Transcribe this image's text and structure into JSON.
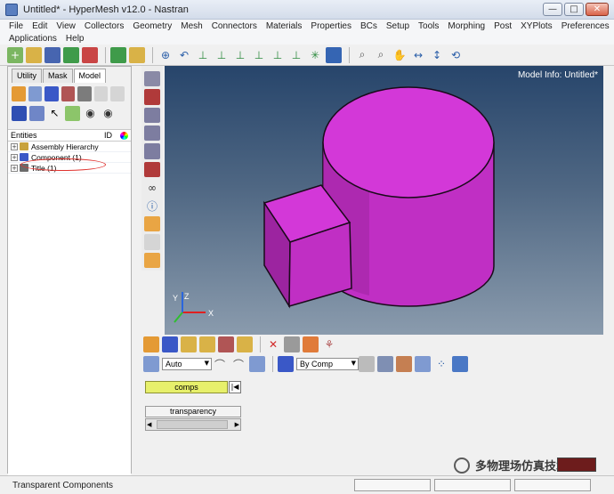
{
  "window": {
    "title": "Untitled* - HyperMesh v12.0 - Nastran",
    "minimize": "—",
    "maximize": "□",
    "close": "✕"
  },
  "menu": {
    "row1": [
      "File",
      "Edit",
      "View",
      "Collectors",
      "Geometry",
      "Mesh",
      "Connectors",
      "Materials",
      "Properties",
      "BCs",
      "Setup",
      "Tools",
      "Morphing",
      "Post",
      "XYPlots",
      "Preferences"
    ],
    "row2": [
      "Applications",
      "Help"
    ]
  },
  "left_panel": {
    "tabs": [
      "Utility",
      "Mask",
      "Model"
    ],
    "active_tab": "Model",
    "entity_header": {
      "title": "Entities",
      "id": "ID"
    },
    "entities": [
      {
        "label": "Assembly Hierarchy",
        "icon": "folder-icon",
        "color": "#c8a23c"
      },
      {
        "label": "Component (1)",
        "icon": "component-icon",
        "color": "#3a58c7"
      },
      {
        "label": "Title (1)",
        "icon": "title-icon",
        "color": "#6b6b6b"
      }
    ]
  },
  "viewport": {
    "model_info": "Model Info: Untitled*",
    "axes": {
      "x": "X",
      "y": "Y",
      "z": "Z"
    },
    "background_top": "#27456b",
    "background_bottom": "#8a9bad",
    "model_color": "#cc33cc"
  },
  "bottom_panel": {
    "geometry_mode": "Auto",
    "color_mode": "By Comp",
    "selector_label": "comps",
    "first_button": "|◀",
    "slider_label": "transparency",
    "transparency": 0.15
  },
  "status": {
    "text": "Transparent Components"
  },
  "watermark": {
    "text": "多物理场仿真技术"
  }
}
